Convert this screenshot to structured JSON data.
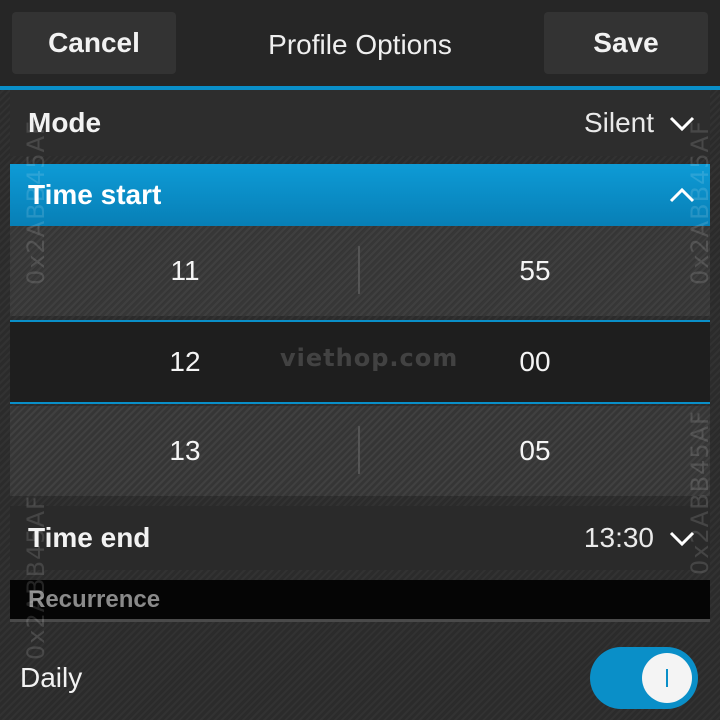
{
  "header": {
    "cancel_label": "Cancel",
    "title": "Profile Options",
    "save_label": "Save"
  },
  "mode": {
    "label": "Mode",
    "value": "Silent"
  },
  "time_start": {
    "label": "Time start"
  },
  "picker": {
    "rows": [
      {
        "hour": "11",
        "minute": "55"
      },
      {
        "hour": "12",
        "minute": "00"
      },
      {
        "hour": "13",
        "minute": "05"
      }
    ],
    "selected_index": 1
  },
  "time_end": {
    "label": "Time end",
    "value": "13:30"
  },
  "recurrence": {
    "header": "Recurrence"
  },
  "daily": {
    "label": "Daily",
    "enabled": true
  },
  "watermarks": {
    "side": "0x2ABB45AF",
    "center": "viethop.com"
  },
  "colors": {
    "accent": "#0a8fc8",
    "background": "#2b2b2b"
  }
}
